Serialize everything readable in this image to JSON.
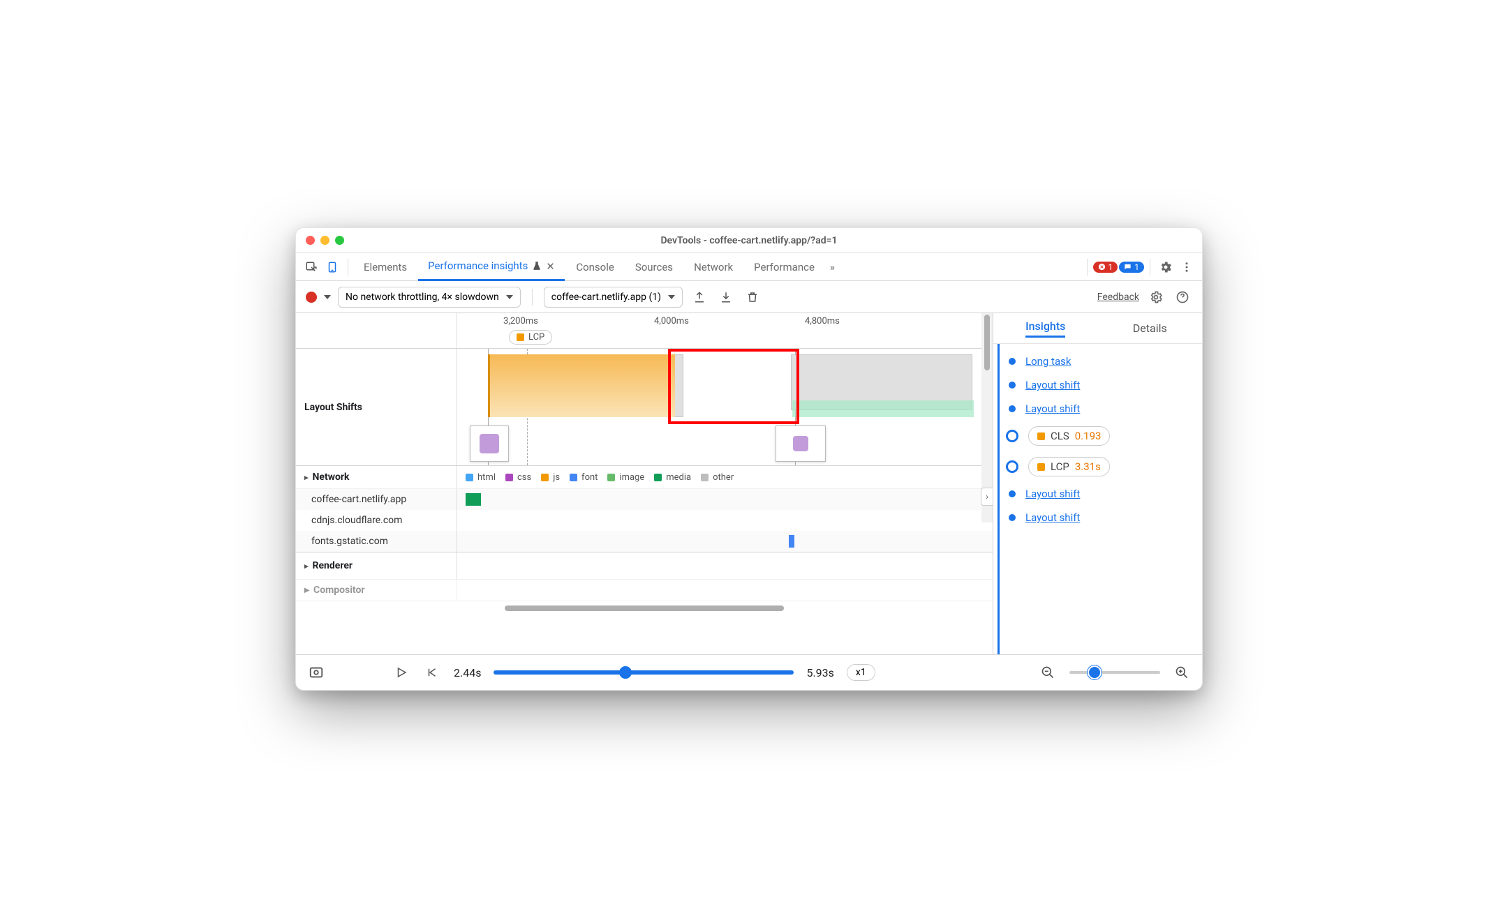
{
  "window": {
    "title": "DevTools - coffee-cart.netlify.app/?ad=1"
  },
  "tabs": {
    "elements": "Elements",
    "perf_insights": "Performance insights",
    "console": "Console",
    "sources": "Sources",
    "network": "Network",
    "performance": "Performance",
    "errors_count": "1",
    "messages_count": "1",
    "more": "»"
  },
  "toolbar": {
    "throttle": "No network throttling, 4× slowdown",
    "recording": "coffee-cart.netlify.app (1)",
    "feedback": "Feedback"
  },
  "ruler": {
    "t1": "3,200ms",
    "t2": "4,000ms",
    "t3": "4,800ms",
    "lcp_label": "LCP"
  },
  "strip": {
    "label": "Layout Shifts"
  },
  "network": {
    "header": "Network",
    "legend": {
      "html": "html",
      "css": "css",
      "js": "js",
      "font": "font",
      "image": "image",
      "media": "media",
      "other": "other"
    },
    "rows": {
      "r1": "coffee-cart.netlify.app",
      "r2": "cdnjs.cloudflare.com",
      "r3": "fonts.gstatic.com"
    }
  },
  "sections": {
    "renderer": "Renderer",
    "compositor": "Compositor"
  },
  "sidebar": {
    "tab_insights": "Insights",
    "tab_details": "Details",
    "items": {
      "long_task": "Long task",
      "layout_shift": "Layout shift",
      "cls_label": "CLS",
      "cls_value": "0.193",
      "lcp_label": "LCP",
      "lcp_value": "3.31s"
    }
  },
  "bottombar": {
    "t_start": "2.44s",
    "t_end": "5.93s",
    "speed": "x1"
  }
}
